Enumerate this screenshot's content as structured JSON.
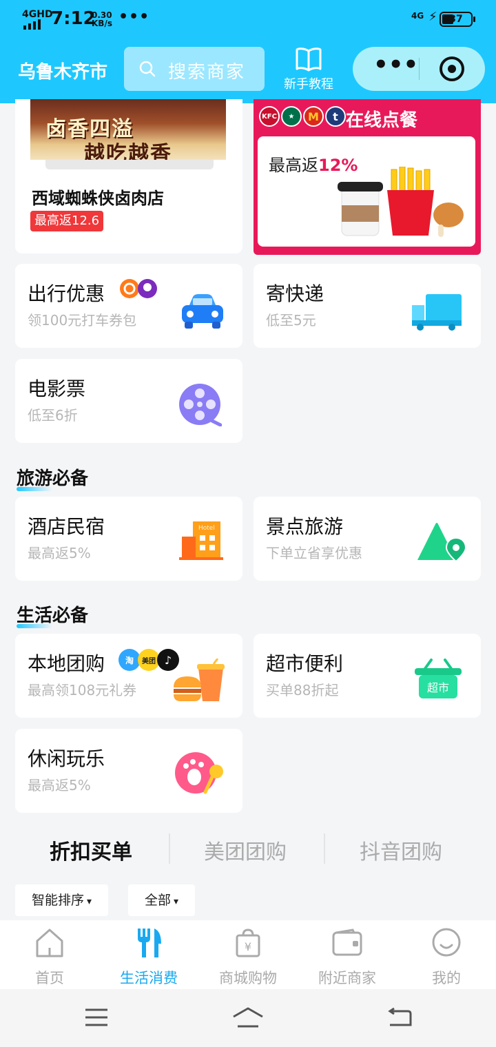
{
  "status": {
    "network": "4GHD",
    "time": "7:12",
    "speed_value": "0.30",
    "speed_unit": "KB/s",
    "overflow": "•••",
    "network_right": "4G",
    "battery": "37"
  },
  "header": {
    "city": "乌鲁木齐市",
    "search_placeholder": "搜索商家",
    "guide_label": "新手教程",
    "more_label": "•••"
  },
  "featured": {
    "shop": {
      "banner_line1": "卤香四溢",
      "banner_line2": "越吃越香",
      "name": "西域蜘蛛侠卤肉店",
      "badge": "最高返12.6"
    },
    "online_order": {
      "title": "在线点餐",
      "logos": [
        "KFC",
        "★",
        "M",
        "t"
      ],
      "rebate_prefix": "最高返",
      "rebate_value": "12%"
    }
  },
  "services": [
    {
      "title": "出行优惠",
      "subtitle": "领100元打车券包",
      "icon": "car-icon"
    },
    {
      "title": "寄快递",
      "subtitle": "低至5元",
      "icon": "truck-icon"
    },
    {
      "title": "电影票",
      "subtitle": "低至6折",
      "icon": "film-reel-icon"
    }
  ],
  "travel": {
    "section_title": "旅游必备",
    "items": [
      {
        "title": "酒店民宿",
        "subtitle": "最高返5%",
        "icon": "hotel-icon",
        "icon_text": "Hotel"
      },
      {
        "title": "景点旅游",
        "subtitle": "下单立省享优惠",
        "icon": "mountain-pin-icon"
      }
    ]
  },
  "life": {
    "section_title": "生活必备",
    "items": [
      {
        "title": "本地团购",
        "subtitle": "最高领108元礼券",
        "icon": "burger-drink-icon",
        "badges": [
          "淘",
          "美团",
          "♪"
        ]
      },
      {
        "title": "超市便利",
        "subtitle": "买单88折起",
        "icon": "basket-icon",
        "icon_text": "超市"
      },
      {
        "title": "休闲玩乐",
        "subtitle": "最高返5%",
        "icon": "paw-mic-icon"
      }
    ]
  },
  "tabs": [
    {
      "label": "折扣买单",
      "active": true
    },
    {
      "label": "美团团购",
      "active": false
    },
    {
      "label": "抖音团购",
      "active": false
    }
  ],
  "filters": [
    {
      "label": "智能排序"
    },
    {
      "label": "全部"
    }
  ],
  "bottom_nav": [
    {
      "label": "首页",
      "icon": "home-icon",
      "active": false
    },
    {
      "label": "生活消费",
      "icon": "fork-knife-icon",
      "active": true
    },
    {
      "label": "商城购物",
      "icon": "shopping-bag-icon",
      "active": false
    },
    {
      "label": "附近商家",
      "icon": "wallet-icon",
      "active": false
    },
    {
      "label": "我的",
      "icon": "smile-icon",
      "active": false
    }
  ],
  "colors": {
    "header_bg": "#1ec8ff",
    "accent": "#1aa9f0",
    "order_red": "#e8195a",
    "badge_red": "#f0373a"
  }
}
